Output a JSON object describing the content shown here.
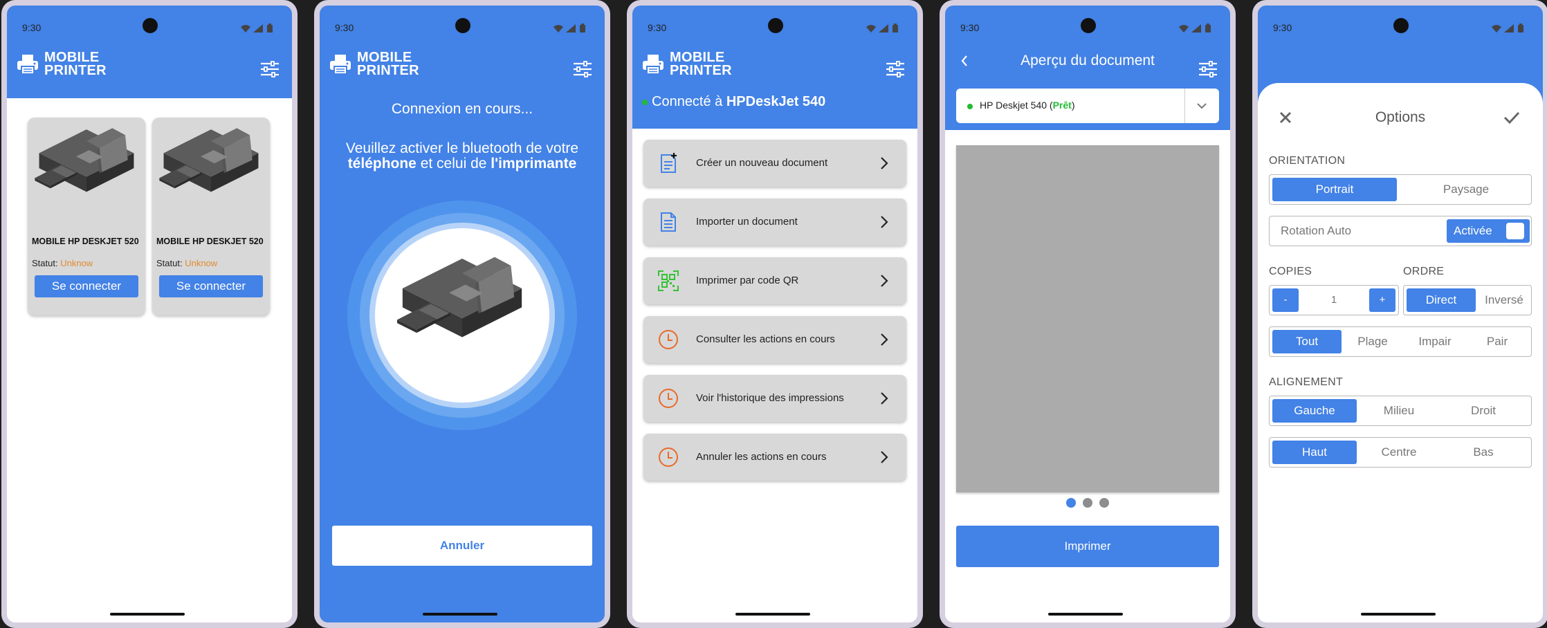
{
  "status": {
    "time": "9:30"
  },
  "brand": {
    "line1": "MOBILE",
    "line2": "PRINTER"
  },
  "screen1": {
    "printers": [
      {
        "name": "MOBILE HP DESKJET 520",
        "status_label": "Statut:",
        "status_value": "Unknow",
        "connect_label": "Se connecter"
      },
      {
        "name": "MOBILE HP DESKJET 520",
        "status_label": "Statut:",
        "status_value": "Unknow",
        "connect_label": "Se connecter"
      }
    ]
  },
  "screen2": {
    "title": "Connexion en cours...",
    "msg_line1": "Veuillez activer le bluetooth de votre",
    "msg_bold1": "téléphone",
    "msg_mid": " et celui de ",
    "msg_bold2": "l'imprimante",
    "cancel_label": "Annuler"
  },
  "screen3": {
    "connected_prefix": "Connecté à ",
    "connected_device": "HPDeskJet 540",
    "menu": [
      {
        "label": "Créer un nouveau document",
        "icon": "new-document-icon"
      },
      {
        "label": "Importer un document",
        "icon": "document-icon"
      },
      {
        "label": "Imprimer par code QR",
        "icon": "qr-code-icon"
      },
      {
        "label": "Consulter les actions en cours",
        "icon": "clock-icon"
      },
      {
        "label": "Voir l'historique des impressions",
        "icon": "clock-icon"
      },
      {
        "label": "Annuler les actions en cours",
        "icon": "clock-icon"
      }
    ]
  },
  "screen4": {
    "title": "Aperçu du document",
    "printer_name": "HP Deskjet 540",
    "printer_status": "Prêt",
    "print_label": "Imprimer",
    "pages": 3,
    "current_page": 1
  },
  "screen5": {
    "title": "Options",
    "orientation": {
      "heading": "ORIENTATION",
      "options": [
        "Portrait",
        "Paysage"
      ],
      "selected": "Portrait"
    },
    "rotation": {
      "label": "Rotation Auto",
      "state": "Activée"
    },
    "copies": {
      "heading": "COPIES",
      "minus": "-",
      "value": "1",
      "plus": "+"
    },
    "order": {
      "heading": "ORDRE",
      "options": [
        "Direct",
        "Inversé"
      ],
      "selected": "Direct"
    },
    "range": {
      "options": [
        "Tout",
        "Plage",
        "Impair",
        "Pair"
      ],
      "selected": "Tout"
    },
    "alignment": {
      "heading": "ALIGNEMENT",
      "horizontal": [
        "Gauche",
        "Milieu",
        "Droit"
      ],
      "h_selected": "Gauche",
      "vertical": [
        "Haut",
        "Centre",
        "Bas"
      ],
      "v_selected": "Haut"
    }
  },
  "colors": {
    "primary": "#4382e6",
    "warning": "#e08a2e",
    "success": "#22bb33",
    "accent_orange": "#e86b2a",
    "qr_green": "#34c234"
  }
}
